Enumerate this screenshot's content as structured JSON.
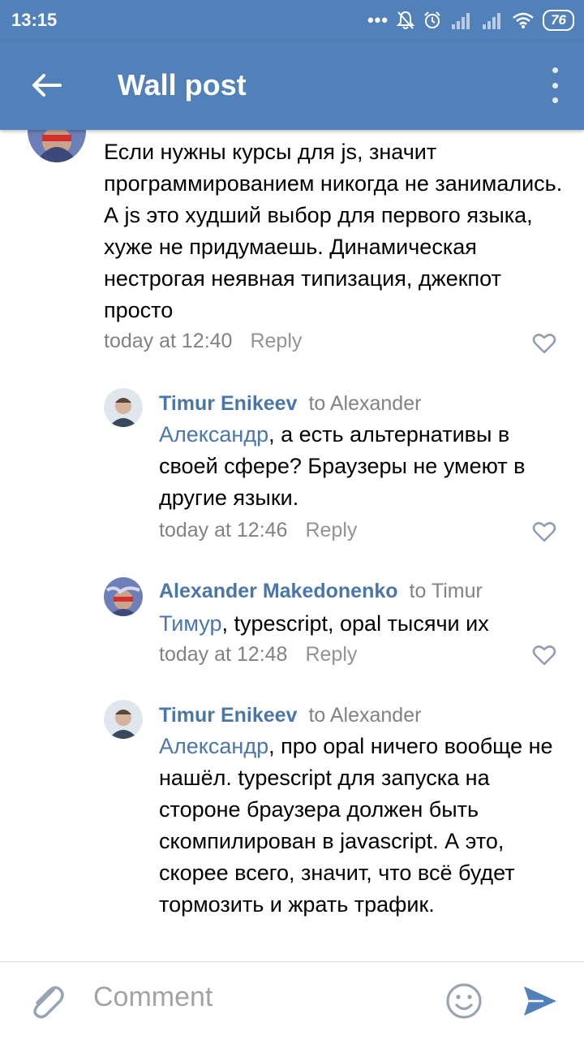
{
  "status_bar": {
    "time": "13:15",
    "battery": "76"
  },
  "app_bar": {
    "title": "Wall post"
  },
  "comments": [
    {
      "text": "Если нужны курсы для js, значит программированием никогда не занимались. А js это худший выбор для первого языка, хуже не придумаешь. Динамическая нестрогая неявная типизация, джекпот просто",
      "time": "today at 12:40",
      "reply": "Reply"
    },
    {
      "author": "Timur Enikeev",
      "to": "to Alexander",
      "mention": "Александр",
      "text": ", а есть альтернативы в своей сфере? Браузеры не умеют в другие языки.",
      "time": "today at 12:46",
      "reply": "Reply"
    },
    {
      "author": "Alexander Makedonenko",
      "to": "to Timur",
      "mention": "Тимур",
      "text": ", typescript, opal тысячи их",
      "time": "today at 12:48",
      "reply": "Reply"
    },
    {
      "author": "Timur Enikeev",
      "to": "to Alexander",
      "mention": "Александр",
      "text": ", про opal ничего вообще не нашёл. typescript для запуска на стороне браузера должен быть скомпилирован в javascript. А это, скорее всего, значит, что всё будет тормозить и жрать трафик."
    }
  ],
  "composer": {
    "placeholder": "Comment"
  },
  "colors": {
    "accent": "#5181b8",
    "link": "#4a76a8",
    "meta": "#828282"
  }
}
